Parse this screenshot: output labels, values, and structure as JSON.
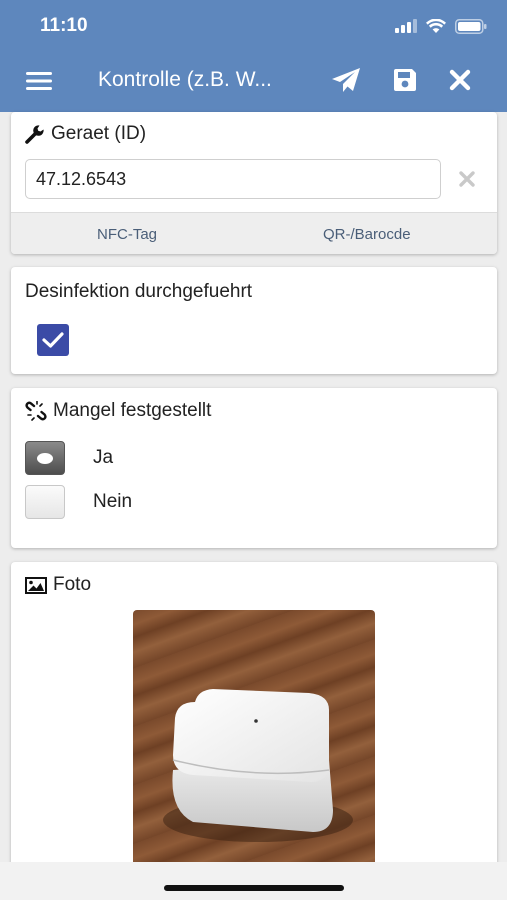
{
  "status_bar": {
    "time": "11:10"
  },
  "nav": {
    "title": "Kontrolle (z.B. W..."
  },
  "device_card": {
    "title": "Geraet (ID)",
    "id_value": "47.12.6543",
    "nfc_label": "NFC-Tag",
    "qr_label": "QR-/Barocde"
  },
  "disinfection_card": {
    "title": "Desinfektion durchgefuehrt",
    "checked": true
  },
  "defect_card": {
    "title": "Mangel festgestellt",
    "options": [
      {
        "label": "Ja",
        "selected": true
      },
      {
        "label": "Nein",
        "selected": false
      }
    ]
  },
  "photo_card": {
    "title": "Foto"
  },
  "colors": {
    "header": "#5e87bd",
    "checkbox": "#3b4ba6",
    "link": "#4a5e78"
  }
}
